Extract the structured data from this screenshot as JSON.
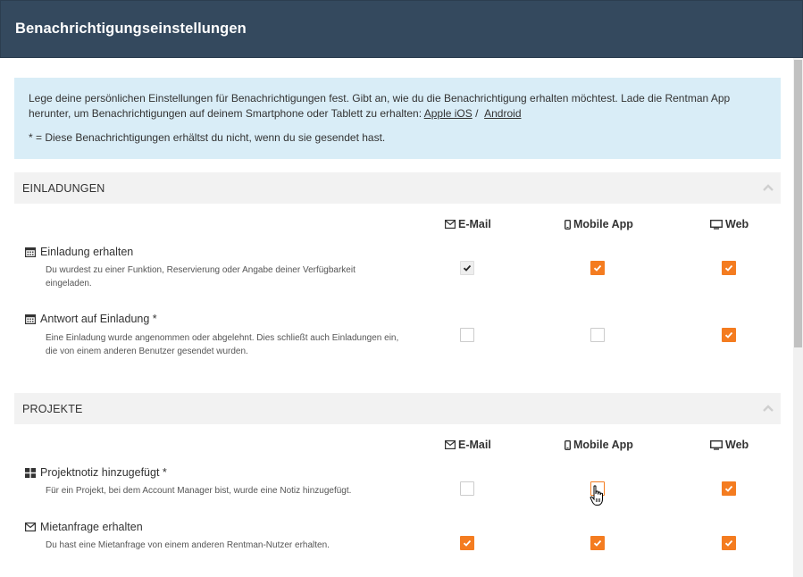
{
  "header": {
    "title": "Benachrichtigungseinstellungen"
  },
  "info": {
    "text": "Lege deine persönlichen Einstellungen für Benachrichtigungen fest. Gibt an, wie du die Benachrichtigung erhalten möchtest. Lade die Rentman App herunter, um Benachrichtigungen auf deinem Smartphone oder Tablett zu erhalten:",
    "link_ios": "Apple iOS",
    "separator": "/",
    "link_android": "Android",
    "note": "* = Diese Benachrichtigungen erhältst du nicht, wenn du sie gesendet hast."
  },
  "columns": {
    "email": "E-Mail",
    "mobile": "Mobile App",
    "web": "Web"
  },
  "sections": [
    {
      "title": "EINLADUNGEN",
      "rows": [
        {
          "title": "Einladung erhalten",
          "icon": "calendar-icon",
          "desc": "Du wurdest zu einer Funktion, Reservierung oder Angabe deiner Verfügbarkeit eingeladen.",
          "email": true,
          "mobile": true,
          "web": true
        },
        {
          "title": "Antwort auf Einladung *",
          "icon": "calendar-icon",
          "desc": "Eine Einladung wurde angenommen oder abgelehnt. Dies schließt auch Einladungen ein, die von einem anderen Benutzer gesendet wurden.",
          "email": false,
          "mobile": false,
          "web": true
        }
      ]
    },
    {
      "title": "PROJEKTE",
      "rows": [
        {
          "title": "Projektnotiz hinzugefügt *",
          "icon": "grid-icon",
          "desc": "Für ein Projekt, bei dem Account Manager bist, wurde eine Notiz hinzugefügt.",
          "email": false,
          "mobile": false,
          "web": true
        },
        {
          "title": "Mietanfrage erhalten",
          "icon": "envelope-icon",
          "desc": "Du hast eine Mietanfrage von einem anderen Rentman-Nutzer erhalten.",
          "email": true,
          "mobile": true,
          "web": true
        }
      ]
    }
  ],
  "colors": {
    "header_bg": "#34495e",
    "info_bg": "#d9edf7",
    "accent": "#f47c20",
    "section_bg": "#f2f2f2"
  }
}
